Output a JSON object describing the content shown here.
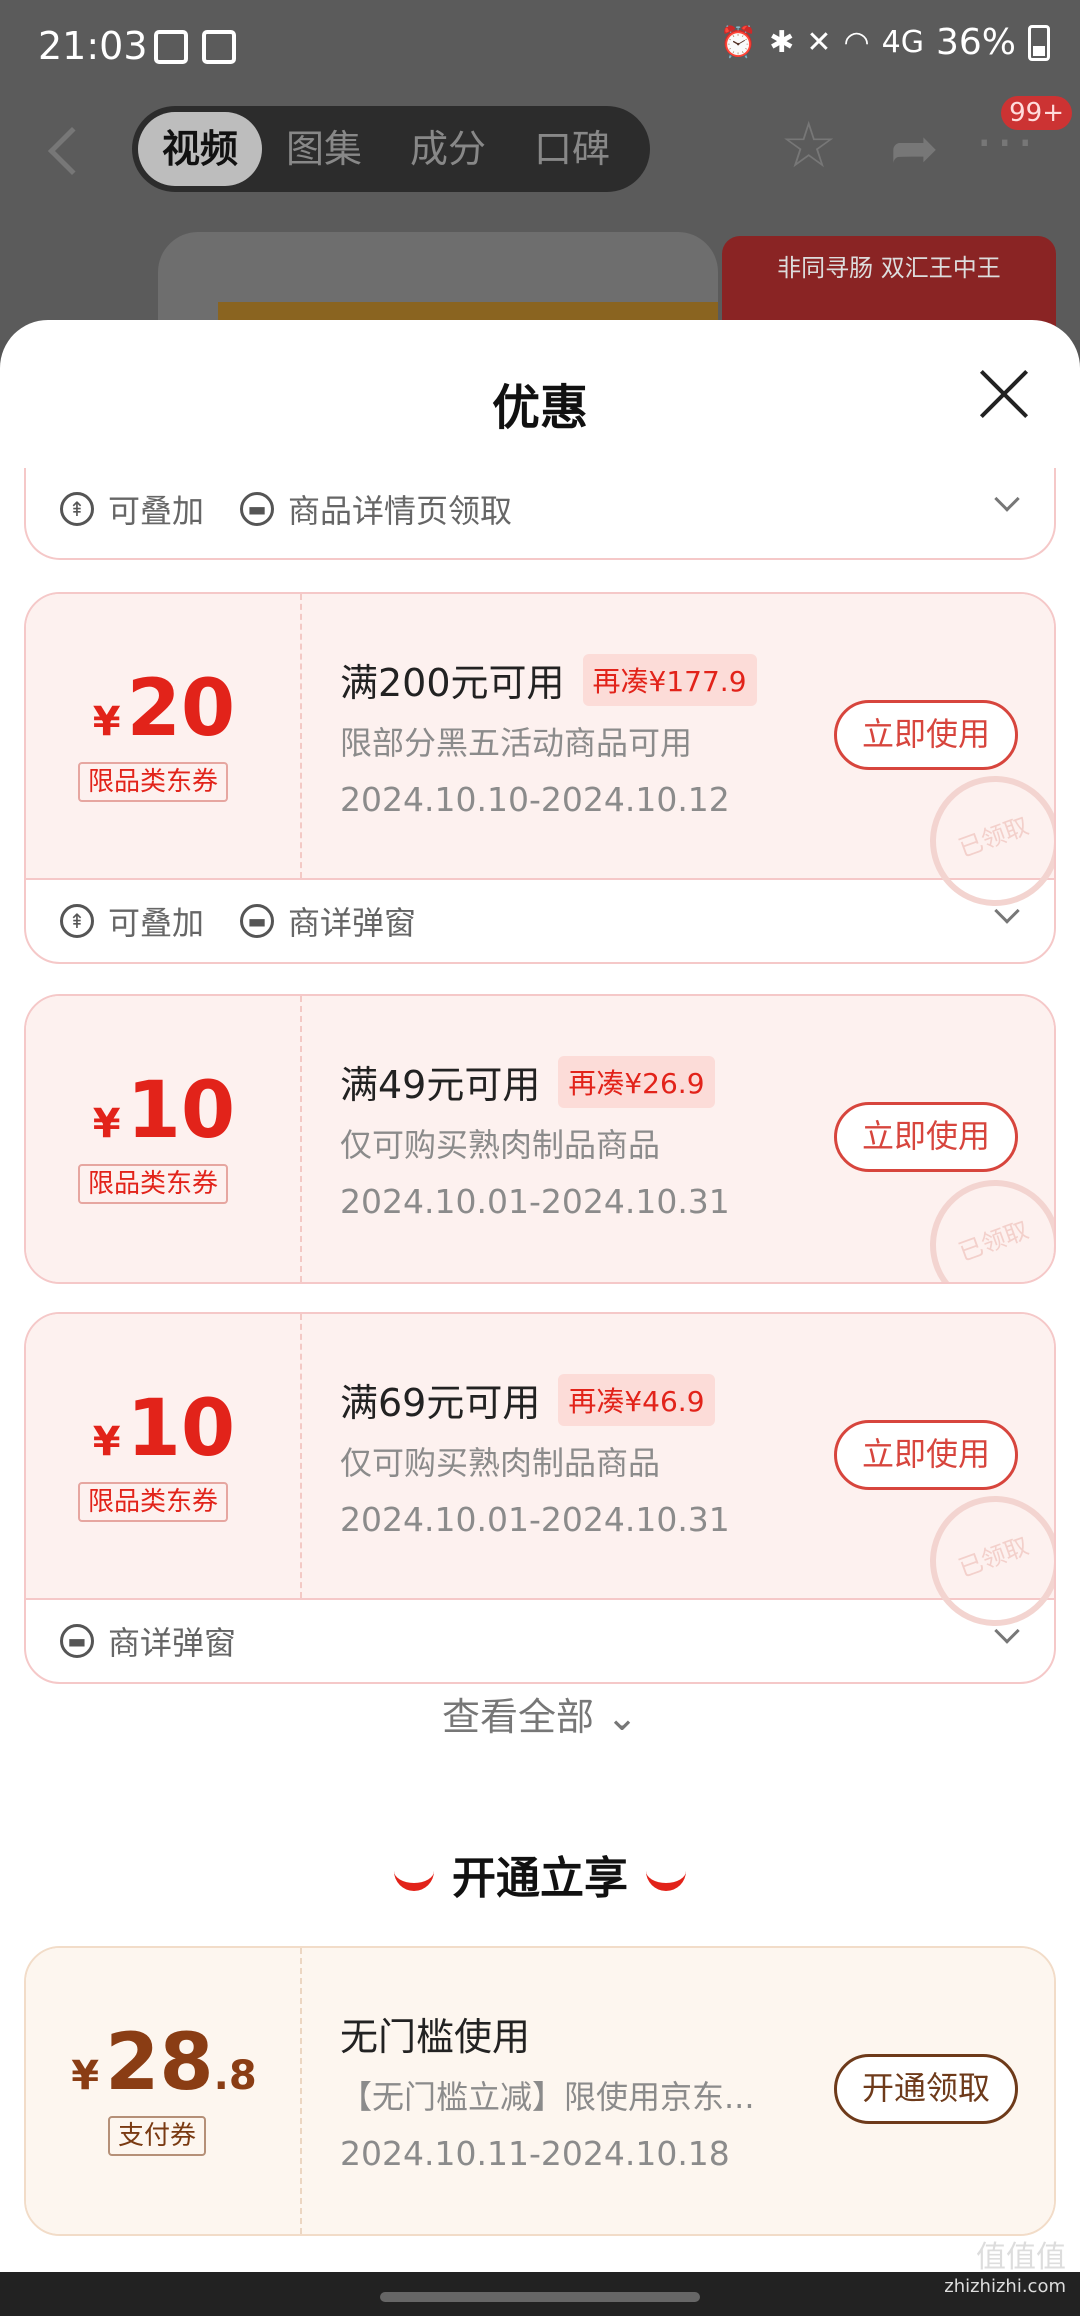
{
  "status": {
    "time": "21:03",
    "network": "4G",
    "battery": "36%"
  },
  "header": {
    "tabs": [
      "视频",
      "图集",
      "成分",
      "口碑"
    ],
    "active_tab": 0,
    "badge": "99+"
  },
  "bg_ad": {
    "text": "非同寻肠 双汇王中王"
  },
  "sheet": {
    "title": "优惠"
  },
  "partial_card": {
    "features": [
      {
        "icon": "stack-icon",
        "label": "可叠加"
      },
      {
        "icon": "ticket-icon",
        "label": "商品详情页领取"
      }
    ]
  },
  "coupons": [
    {
      "yen": "¥",
      "amount": "20",
      "tag": "限品类东券",
      "condition": "满200元可用",
      "need": "再凑¥177.9",
      "desc": "限部分黑五活动商品可用",
      "date": "2024.10.10-2024.10.12",
      "button": "立即使用",
      "stamp": "已领取",
      "features": [
        {
          "icon": "stack-icon",
          "label": "可叠加"
        },
        {
          "icon": "ticket-icon",
          "label": "商详弹窗"
        }
      ]
    },
    {
      "yen": "¥",
      "amount": "10",
      "tag": "限品类东券",
      "condition": "满49元可用",
      "need": "再凑¥26.9",
      "desc": "仅可购买熟肉制品商品",
      "date": "2024.10.01-2024.10.31",
      "button": "立即使用",
      "stamp": "已领取"
    },
    {
      "yen": "¥",
      "amount": "10",
      "tag": "限品类东券",
      "condition": "满69元可用",
      "need": "再凑¥46.9",
      "desc": "仅可购买熟肉制品商品",
      "date": "2024.10.01-2024.10.31",
      "button": "立即使用",
      "stamp": "已领取",
      "features": [
        {
          "icon": "ticket-icon",
          "label": "商详弹窗"
        }
      ]
    }
  ],
  "view_all": "查看全部",
  "section_title": "开通立享",
  "pay_coupon": {
    "yen": "¥",
    "amount": "28",
    "amount_decimal": ".8",
    "tag": "支付券",
    "condition": "无门槛使用",
    "desc": "【无门槛立减】限使用京东...",
    "date": "2024.10.11-2024.10.18",
    "button": "开通领取"
  },
  "watermark": {
    "line1": "值值值",
    "line2": "zhizhizhi.com"
  }
}
